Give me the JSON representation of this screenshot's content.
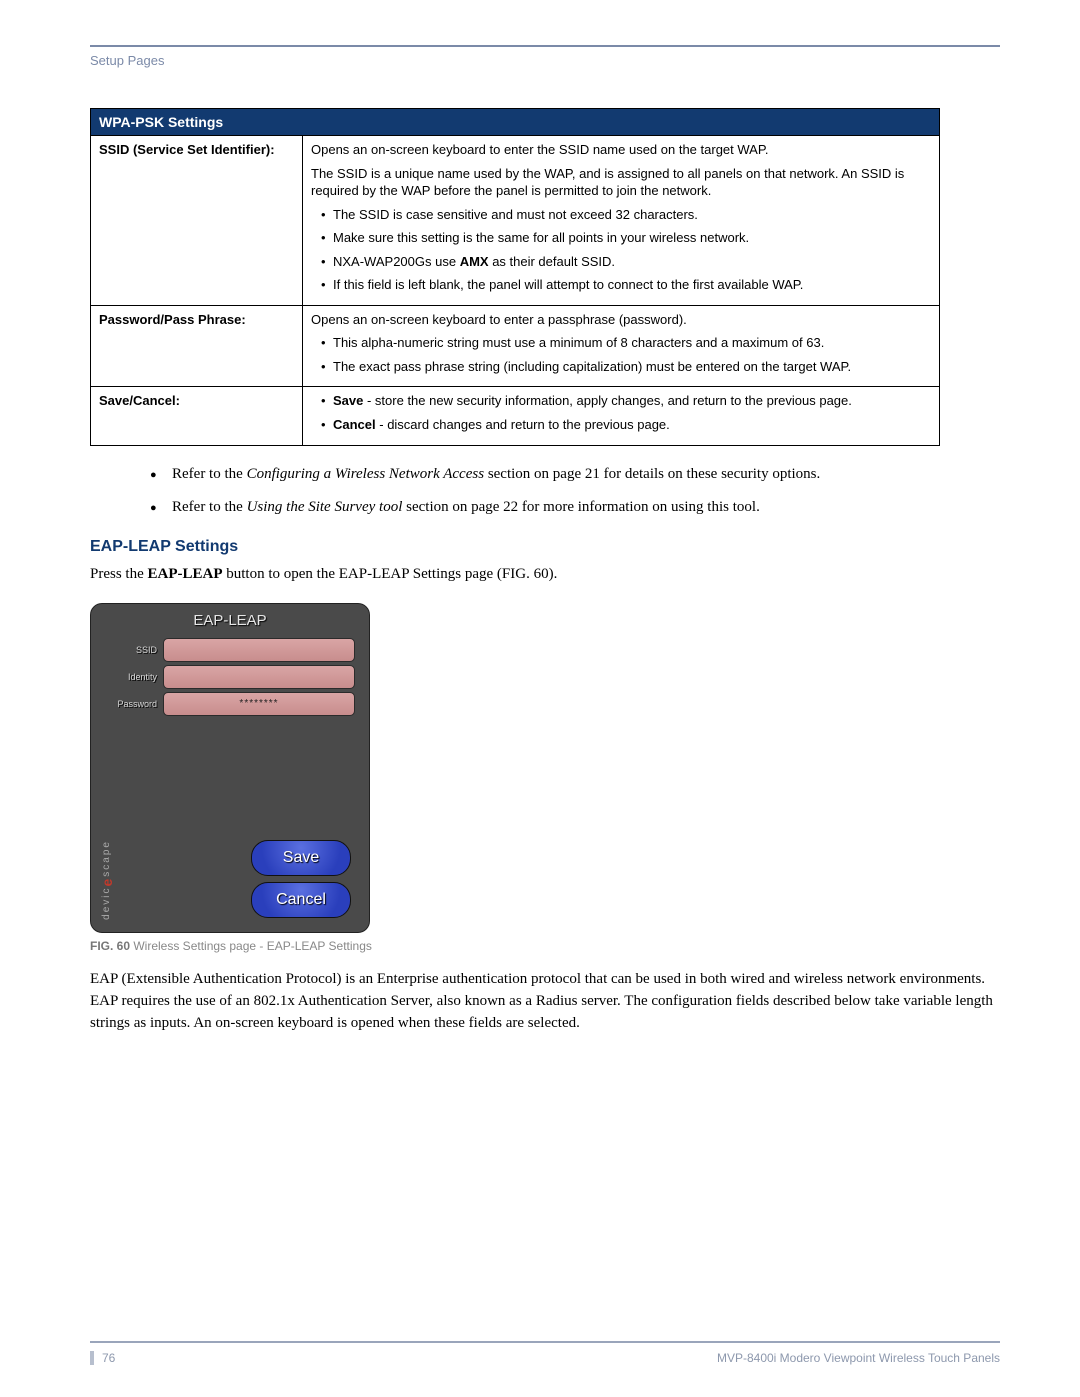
{
  "header": {
    "section": "Setup Pages"
  },
  "table": {
    "title": "WPA-PSK Settings",
    "rows": [
      {
        "label": "SSID (Service Set Identifier):",
        "p1": "Opens an on-screen keyboard to enter the SSID name used on the target WAP.",
        "p2": "The SSID is a unique name used by the WAP, and is assigned to all panels on that network. An SSID is required by the WAP before the panel is permitted to join the network.",
        "b1": "The SSID is case sensitive and must not exceed 32 characters.",
        "b2": "Make sure this setting is the same for all points in your wireless network.",
        "b3a": "NXA-WAP200Gs use ",
        "b3b": "AMX",
        "b3c": " as their default SSID.",
        "b4": "If this field is left blank, the panel will attempt to connect to the first available WAP."
      },
      {
        "label": "Password/Pass Phrase:",
        "p1": "Opens an on-screen keyboard to enter a passphrase (password).",
        "b1": "This alpha-numeric string must use a minimum of 8 characters and a maximum of 63.",
        "b2": "The exact pass phrase string (including capitalization) must be entered on the target WAP."
      },
      {
        "label": "Save/Cancel:",
        "b1a": "Save",
        "b1b": " - store the new security information, apply changes, and return to the previous page.",
        "b2a": "Cancel",
        "b2b": " - discard changes and return to the previous page."
      }
    ]
  },
  "refer": {
    "r1a": "Refer to the ",
    "r1b": "Configuring a Wireless Network Access",
    "r1c": " section on page 21 for details on these security options.",
    "r2a": "Refer to the ",
    "r2b": "Using the Site Survey tool",
    "r2c": " section on page 22 for more information on using this tool."
  },
  "section_heading": "EAP-LEAP Settings",
  "press_a": "Press the ",
  "press_b": "EAP-LEAP",
  "press_c": " button to open the EAP-LEAP Settings page (FIG. 60).",
  "panel": {
    "title": "EAP-LEAP",
    "ssid_label": "SSID",
    "identity_label": "Identity",
    "password_label": "Password",
    "password_value": "********",
    "save": "Save",
    "cancel": "Cancel",
    "brand": "devicescape"
  },
  "figcap_a": "FIG. 60",
  "figcap_b": "  Wireless Settings page - EAP-LEAP Settings",
  "body_para": "EAP (Extensible Authentication Protocol) is an Enterprise authentication protocol that can be used in both wired and wireless network environments. EAP requires the use of an 802.1x Authentication Server, also known as a Radius server. The configuration fields described below take variable length strings as inputs. An on-screen keyboard is opened when these fields are selected.",
  "footer": {
    "page": "76",
    "doc": "MVP-8400i Modero Viewpoint Wireless Touch Panels"
  }
}
